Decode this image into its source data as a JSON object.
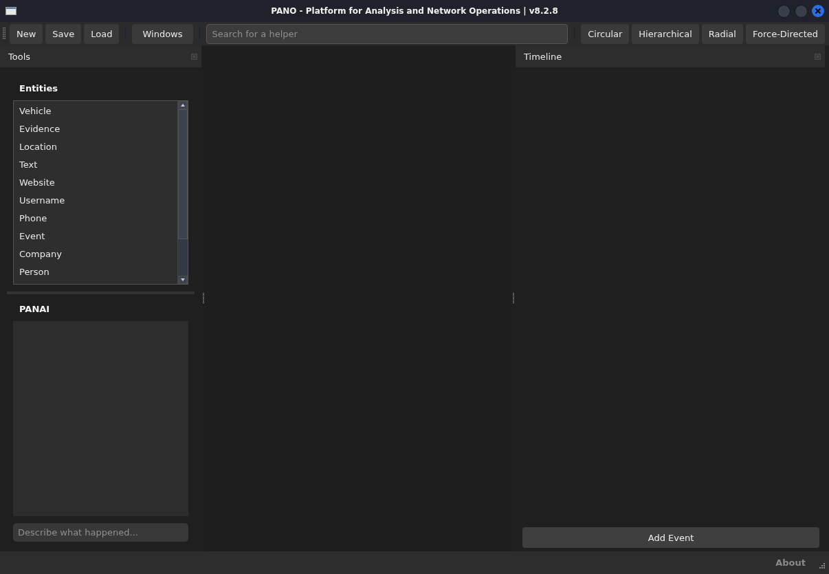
{
  "window": {
    "title": "PANO - Platform for Analysis and Network Operations | v8.2.8"
  },
  "toolbar": {
    "file_buttons": [
      "New",
      "Save",
      "Load"
    ],
    "windows_button": "Windows",
    "search": {
      "placeholder": "Search for a helper"
    },
    "layout_buttons": [
      "Circular",
      "Hierarchical",
      "Radial",
      "Force-Directed"
    ]
  },
  "tools_panel": {
    "title": "Tools",
    "entities": {
      "heading": "Entities",
      "items": [
        "Vehicle",
        "Evidence",
        "Location",
        "Text",
        "Website",
        "Username",
        "Phone",
        "Event",
        "Company",
        "Person"
      ]
    },
    "panai": {
      "heading": "PANAI",
      "input": {
        "placeholder": "Describe what happened..."
      }
    }
  },
  "timeline_panel": {
    "title": "Timeline",
    "add_button": "Add Event"
  },
  "status_bar": {
    "about": "About"
  }
}
